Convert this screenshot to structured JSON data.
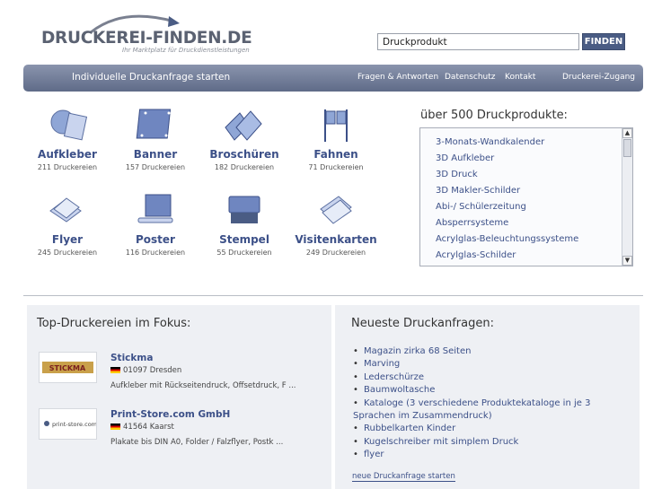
{
  "brand": {
    "name": "DRUCKEREI-FINDEN.DE",
    "tagline": "Ihr Marktplatz für Druckdienstleistungen"
  },
  "search": {
    "value": "Druckprodukt",
    "button_label": "FINDEN"
  },
  "nav": {
    "left_link": "Individuelle Druckanfrage starten",
    "links": [
      "Fragen & Antworten",
      "Datenschutz",
      "Kontakt",
      "Druckerei-Zugang"
    ]
  },
  "categories": [
    {
      "name": "Aufkleber",
      "count": "211 Druckereien",
      "icon": "sticker-icon"
    },
    {
      "name": "Banner",
      "count": "157 Druckereien",
      "icon": "banner-icon"
    },
    {
      "name": "Broschüren",
      "count": "182 Druckereien",
      "icon": "brochure-icon"
    },
    {
      "name": "Fahnen",
      "count": "71 Druckereien",
      "icon": "flag-icon"
    },
    {
      "name": "Flyer",
      "count": "245 Druckereien",
      "icon": "flyer-icon"
    },
    {
      "name": "Poster",
      "count": "116 Druckereien",
      "icon": "poster-icon"
    },
    {
      "name": "Stempel",
      "count": "55 Druckereien",
      "icon": "stamp-icon"
    },
    {
      "name": "Visitenkarten",
      "count": "249 Druckereien",
      "icon": "business-card-icon"
    }
  ],
  "products": {
    "title": "über 500 Druckprodukte:",
    "items": [
      "3-Monats-Wandkalender",
      "3D Aufkleber",
      "3D Druck",
      "3D Makler-Schilder",
      "Abi-/ Schülerzeitung",
      "Absperrsysteme",
      "Acrylglas-Beleuchtungssysteme",
      "Acrylglas-Schilder"
    ]
  },
  "top_printers": {
    "title": "Top-Druckereien im Fokus:",
    "items": [
      {
        "name": "Stickma",
        "location": "01097 Dresden",
        "description": "Aufkleber mit Rückseitendruck, Offsetdruck, F ...",
        "logo_text": "STICKMA"
      },
      {
        "name": "Print-Store.com GmbH",
        "location": "41564 Kaarst",
        "description": "Plakate bis DIN A0, Folder / Falzflyer, Postk ...",
        "logo_text": "print-store.com"
      }
    ]
  },
  "requests": {
    "title": "Neueste Druckanfragen:",
    "items": [
      "Magazin zirka 68 Seiten",
      "Marving",
      "Lederschürze",
      "Baumwoltasche",
      "Kataloge (3 verschiedene Produktekataloge in je 3",
      "Rubbelkarten Kinder",
      "Kugelschreiber mit simplem Druck",
      "flyer"
    ],
    "wrap_text": "Sprachen im Zusammendruck)",
    "more_link": "neue Druckanfrage starten"
  },
  "colors": {
    "nav_bar": "#6b7794",
    "link": "#3c5088",
    "button": "#4a5c84",
    "panel": "#eef0f4"
  }
}
